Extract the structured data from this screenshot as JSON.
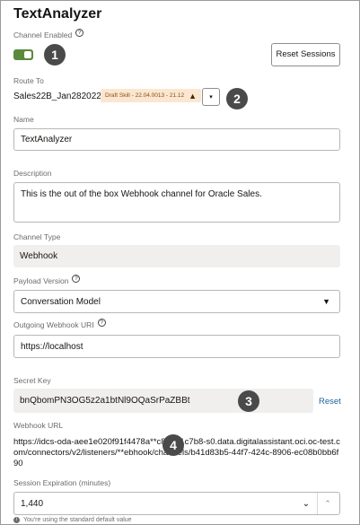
{
  "title": "TextAnalyzer",
  "channel_enabled": {
    "label": "Channel Enabled",
    "help": "?",
    "on": true
  },
  "reset_sessions_label": "Reset Sessions",
  "route_to": {
    "label": "Route To",
    "value": "Sales22B_Jan282022",
    "badge": "Draft Skill - 22.04.0013 - 21.12",
    "warn_icon": "▲",
    "caret": "▾"
  },
  "name": {
    "label": "Name",
    "value": "TextAnalyzer"
  },
  "description": {
    "label": "Description",
    "value": "This is the out of the box Webhook channel for Oracle Sales."
  },
  "channel_type": {
    "label": "Channel Type",
    "value": "Webhook"
  },
  "payload_version": {
    "label": "Payload Version",
    "help": "?",
    "value": "Conversation Model",
    "caret": "▼"
  },
  "outgoing_uri": {
    "label": "Outgoing Webhook URI",
    "help": "?",
    "value": "https://localhost"
  },
  "secret_key": {
    "label": "Secret Key",
    "value": "bnQbomPN3OG5z2a1btNl9OQaSrPaZBBt",
    "reset_label": "Reset"
  },
  "webhook_url": {
    "label": "Webhook URL",
    "value": "https://idcs-oda-aee1e020f91f4478a**c867d1c7b8-s0.data.digitalassistant.oci.oc-test.com/connectors/v2/listeners/**ebhook/channels/b41d83b5-44f7-424c-8906-ec08b0bb6f90"
  },
  "session_expiration": {
    "label": "Session Expiration (minutes)",
    "value": "1,440",
    "down": "⌄",
    "up": "⌃",
    "hint": "You're using the standard default value",
    "hint_icon": "i"
  },
  "callouts": [
    "1",
    "2",
    "3",
    "4"
  ]
}
